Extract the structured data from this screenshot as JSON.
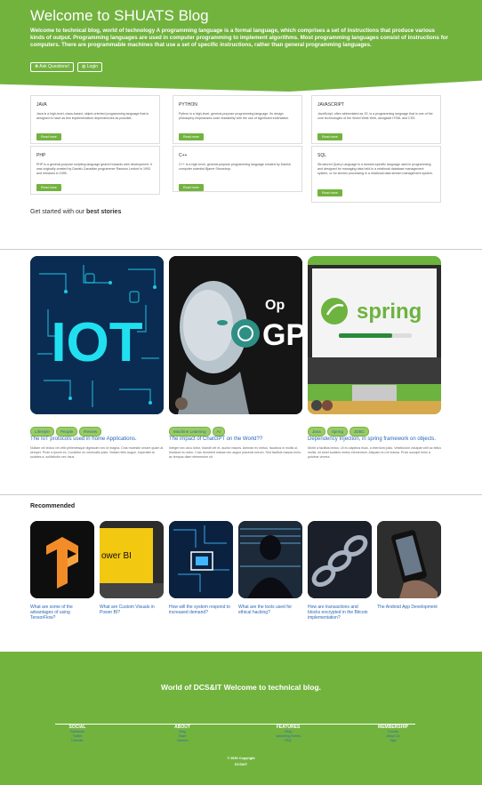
{
  "hero": {
    "title": "Welcome to SHUATS Blog",
    "description": "Welcome to technical blog, world of technology A programming language is a formal language, which comprises a set of instructions that produce various kinds of output. Programming languages are used in computer programming to implement algorithms. Most programming languages consist of instructions for computers. There are programmable machines that use a set of specific instructions, rather than general programming languages.",
    "ask_label": "❋ Ask Questions!",
    "login_label": "◍ Login"
  },
  "cards": [
    {
      "title": "JAVA",
      "desc": "Java is a high-level, class-based, object-oriented programming language that is designed to have as few implementation dependencies as possible.",
      "btn": "Read more"
    },
    {
      "title": "PYTHON",
      "desc": "Python is a high-level, general-purpose programming language. Its design philosophy emphasizes code readability with the use of significant indentation.",
      "btn": "Read more"
    },
    {
      "title": "JAVASCRIPT",
      "desc": "JavaScript, often abbreviated as JS, is a programming language that is one of the core technologies of the World Wide Web, alongside HTML and CSS.",
      "btn": "Read more"
    },
    {
      "title": "PHP",
      "desc": "PHP is a general-purpose scripting language geared towards web development. It was originally created by Danish-Canadian programmer Rasmus Lerdorf in 1993 and released in 1995.",
      "btn": "Read more"
    },
    {
      "title": "C++",
      "desc": "C++ is a high-level, general-purpose programming language created by Danish computer scientist Bjarne Stroustrup.",
      "btn": "Read more"
    },
    {
      "title": "SQL",
      "desc": "Structured Query Language is a domain-specific language used in programming and designed for managing data held in a relational database management system, or for stream processing in a relational data stream management system.",
      "btn": "Read more"
    }
  ],
  "get_started": {
    "prefix": "Get started with our",
    "bold": "best stories"
  },
  "stories": [
    {
      "tags": [
        "Lifestyle",
        "People",
        "Review"
      ],
      "title": "The IoT protocols used in home Applications.",
      "desc": "Nullam vel lectus vel velit pellentesque dignissim nec id magna. Cras molestie ornare quam at semper. Proin a ipsum ex. Curabitur eu venenatis justo. Nullam felis augue, imperdiet at sodales a, sollicitudin nec risus."
    },
    {
      "tags": [
        "Machine Learning",
        "AI"
      ],
      "title": "The impact of ChatGPT on the World??",
      "desc": "Integer nec arcu tortor, blandit vel et, auctor mauris. Aenean ex metus, faucibus in mollis ut, tincidunt eu dolor. Cras hendrerit massa nec augue placerat rutrum. Sed facilisis massa enim, ac tempus diam elementum sit."
    },
    {
      "tags": [
        "Java",
        "Spring",
        "JDBC"
      ],
      "title": "Dependency Injection, in spring framework on objects.",
      "desc": "Morbi a facilisis lectus. Ut eu dapibus risus, a interdum justo. Vestibulum volutpat velit ac tellus mollis, sit amet sodales metus elementum. Aliquam eu mi massa. Proin suscipit enim a pulvinar viverra."
    }
  ],
  "recommended": {
    "heading": "Recommended",
    "items": [
      {
        "title": "What are some of the advantages of using TensorFlow?"
      },
      {
        "title": "What are Custom Visuals in Power BI?",
        "img_text": "ower BI"
      },
      {
        "title": "How will the system respond to increased demand?"
      },
      {
        "title": "What are the tools used for ethical hacking?"
      },
      {
        "title": "How are transactions and blocks encrypted in the Bitcoin implementation?"
      },
      {
        "title": "The Android App Development"
      }
    ]
  },
  "footer": {
    "title": "World of DCS&IT Welcome to technical blog.",
    "cols": [
      {
        "h": "SOCIAL",
        "links": [
          "Facebook",
          "Twitter",
          "Linkedin"
        ]
      },
      {
        "h": "ABOUT",
        "links": [
          "Blog",
          "Team",
          "Careers"
        ]
      },
      {
        "h": "FEATURES",
        "links": [
          "Blog",
          "Upcoming Events",
          "FAQ"
        ]
      },
      {
        "h": "MEMBERSHIP",
        "links": [
          "Course",
          "About Us",
          "Sign"
        ]
      }
    ],
    "copyright": "© 2030 Copyright",
    "org": "DCS&IT"
  },
  "colors": {
    "accent": "#72b33e",
    "link": "#2a67b5"
  },
  "story_images": {
    "iot_text": "IOT",
    "ai_text": "GP",
    "ai_brand": "Op",
    "spring_text": "spring"
  }
}
